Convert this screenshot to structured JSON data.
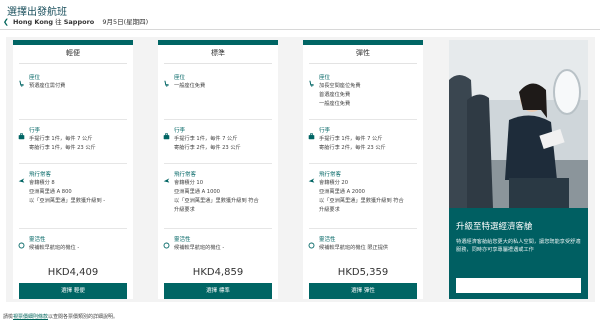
{
  "header": {
    "title": "選擇出發航班",
    "origin": "Hong Kong",
    "route_connector": "往",
    "destination": "Sapporo",
    "date": "9月5日(星期四)"
  },
  "fares": [
    {
      "name": "輕便",
      "seat_title": "座位",
      "seat_lines": [
        "預選座位需付費"
      ],
      "baggage_title": "行李",
      "baggage_lines": [
        "手提行李  1件，每件 7 公斤",
        "寄艙行李  1件，每件 23 公斤"
      ],
      "miles_title": "飛行常客",
      "miles_lines": [
        "會籍積分  8",
        "亞洲萬里通  A 800",
        "以「亞洲萬里通」里數獲升級到  -"
      ],
      "flex_title": "靈活性",
      "flex_lines": [
        "候補較早航班的機位  -"
      ],
      "price": "HKD4,409",
      "button": "選擇 輕便"
    },
    {
      "name": "標準",
      "seat_title": "座位",
      "seat_lines": [
        "一般座位免費"
      ],
      "baggage_title": "行李",
      "baggage_lines": [
        "手提行李  1件，每件 7 公斤",
        "寄艙行李  2件，每件 23 公斤"
      ],
      "miles_title": "飛行常客",
      "miles_lines": [
        "會籍積分  10",
        "亞洲萬里通  A 1000",
        "以「亞洲萬里通」里數獲升級到  符合",
        "升級要求"
      ],
      "flex_title": "靈活性",
      "flex_lines": [
        "候補較早航班的機位  -"
      ],
      "price": "HKD4,859",
      "button": "選擇 標準"
    },
    {
      "name": "彈性",
      "seat_title": "座位",
      "seat_lines": [
        "加長空間座位免費",
        "首選座位免費",
        "一般座位免費"
      ],
      "baggage_title": "行李",
      "baggage_lines": [
        "手提行李  1件，每件 7 公斤",
        "寄艙行李  2件，每件 23 公斤"
      ],
      "miles_title": "飛行常客",
      "miles_lines": [
        "會籍積分  20",
        "亞洲萬里通  A 2000",
        "以「亞洲萬里通」里數獲升級到  符合",
        "升級要求"
      ],
      "flex_title": "靈活性",
      "flex_lines": [
        "候補較早航班的機位  限正提供"
      ],
      "price": "HKD5,359",
      "button": "選擇 彈性"
    }
  ],
  "promo": {
    "title": "升級至特選經濟客艙",
    "desc": "特選經濟客艙給您更大的私人空間，讓您既能享受舒適服務，同時亦可享專屬禮遇或工作"
  },
  "footnote": {
    "prefix": "請檢",
    "link": "視票價細則條款",
    "suffix": "以查閱各票價類別的詳細說明。"
  },
  "colors": {
    "brand": "#006564",
    "panel": "#f3f3f3",
    "promo_bg": "#005f62"
  },
  "icons": [
    "back-arrow-icon",
    "seat-icon",
    "baggage-icon",
    "frequent-flyer-icon",
    "flexibility-icon"
  ]
}
